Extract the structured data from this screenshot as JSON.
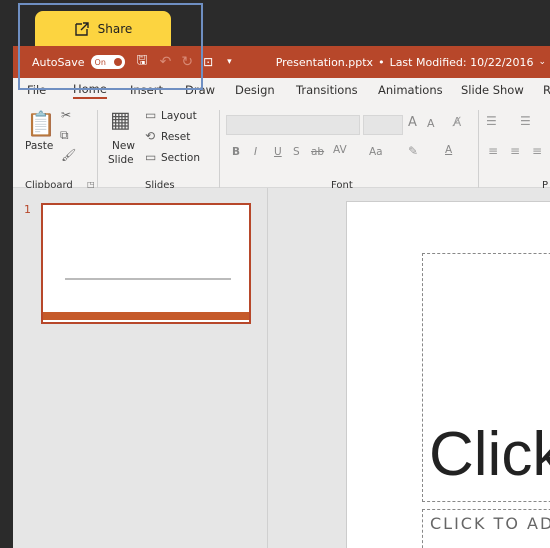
{
  "share": {
    "label": "Share",
    "icon": "share-icon"
  },
  "titlebar": {
    "autosave_label": "AutoSave",
    "autosave_state": "On",
    "file_name": "Presentation.pptx",
    "separator": "•",
    "last_modified": "Last Modified: 10/22/2016"
  },
  "tabs": [
    "File",
    "Home",
    "Insert",
    "Draw",
    "Design",
    "Transitions",
    "Animations",
    "Slide Show",
    "R"
  ],
  "active_tab": "Home",
  "ribbon": {
    "clipboard": {
      "paste": "Paste",
      "group": "Clipboard"
    },
    "slides": {
      "new_slide_1": "New",
      "new_slide_2": "Slide",
      "layout": "Layout",
      "reset": "Reset",
      "section": "Section",
      "group": "Slides"
    },
    "font": {
      "group": "Font",
      "bold": "B",
      "italic": "I",
      "underline": "U",
      "shadow": "S",
      "strike": "ab",
      "spacing": "AV",
      "case": "Aa",
      "grow": "A",
      "shrink": "A",
      "font_color": "A"
    },
    "paragraph": {
      "group": "P"
    }
  },
  "thumbnails": [
    {
      "number": "1"
    }
  ],
  "slide": {
    "title_visible": "Click",
    "subtitle_visible": "CLICK TO AD"
  },
  "colors": {
    "accent": "#b7472a",
    "share": "#fcd440",
    "highlight": "#6f8fc2"
  }
}
